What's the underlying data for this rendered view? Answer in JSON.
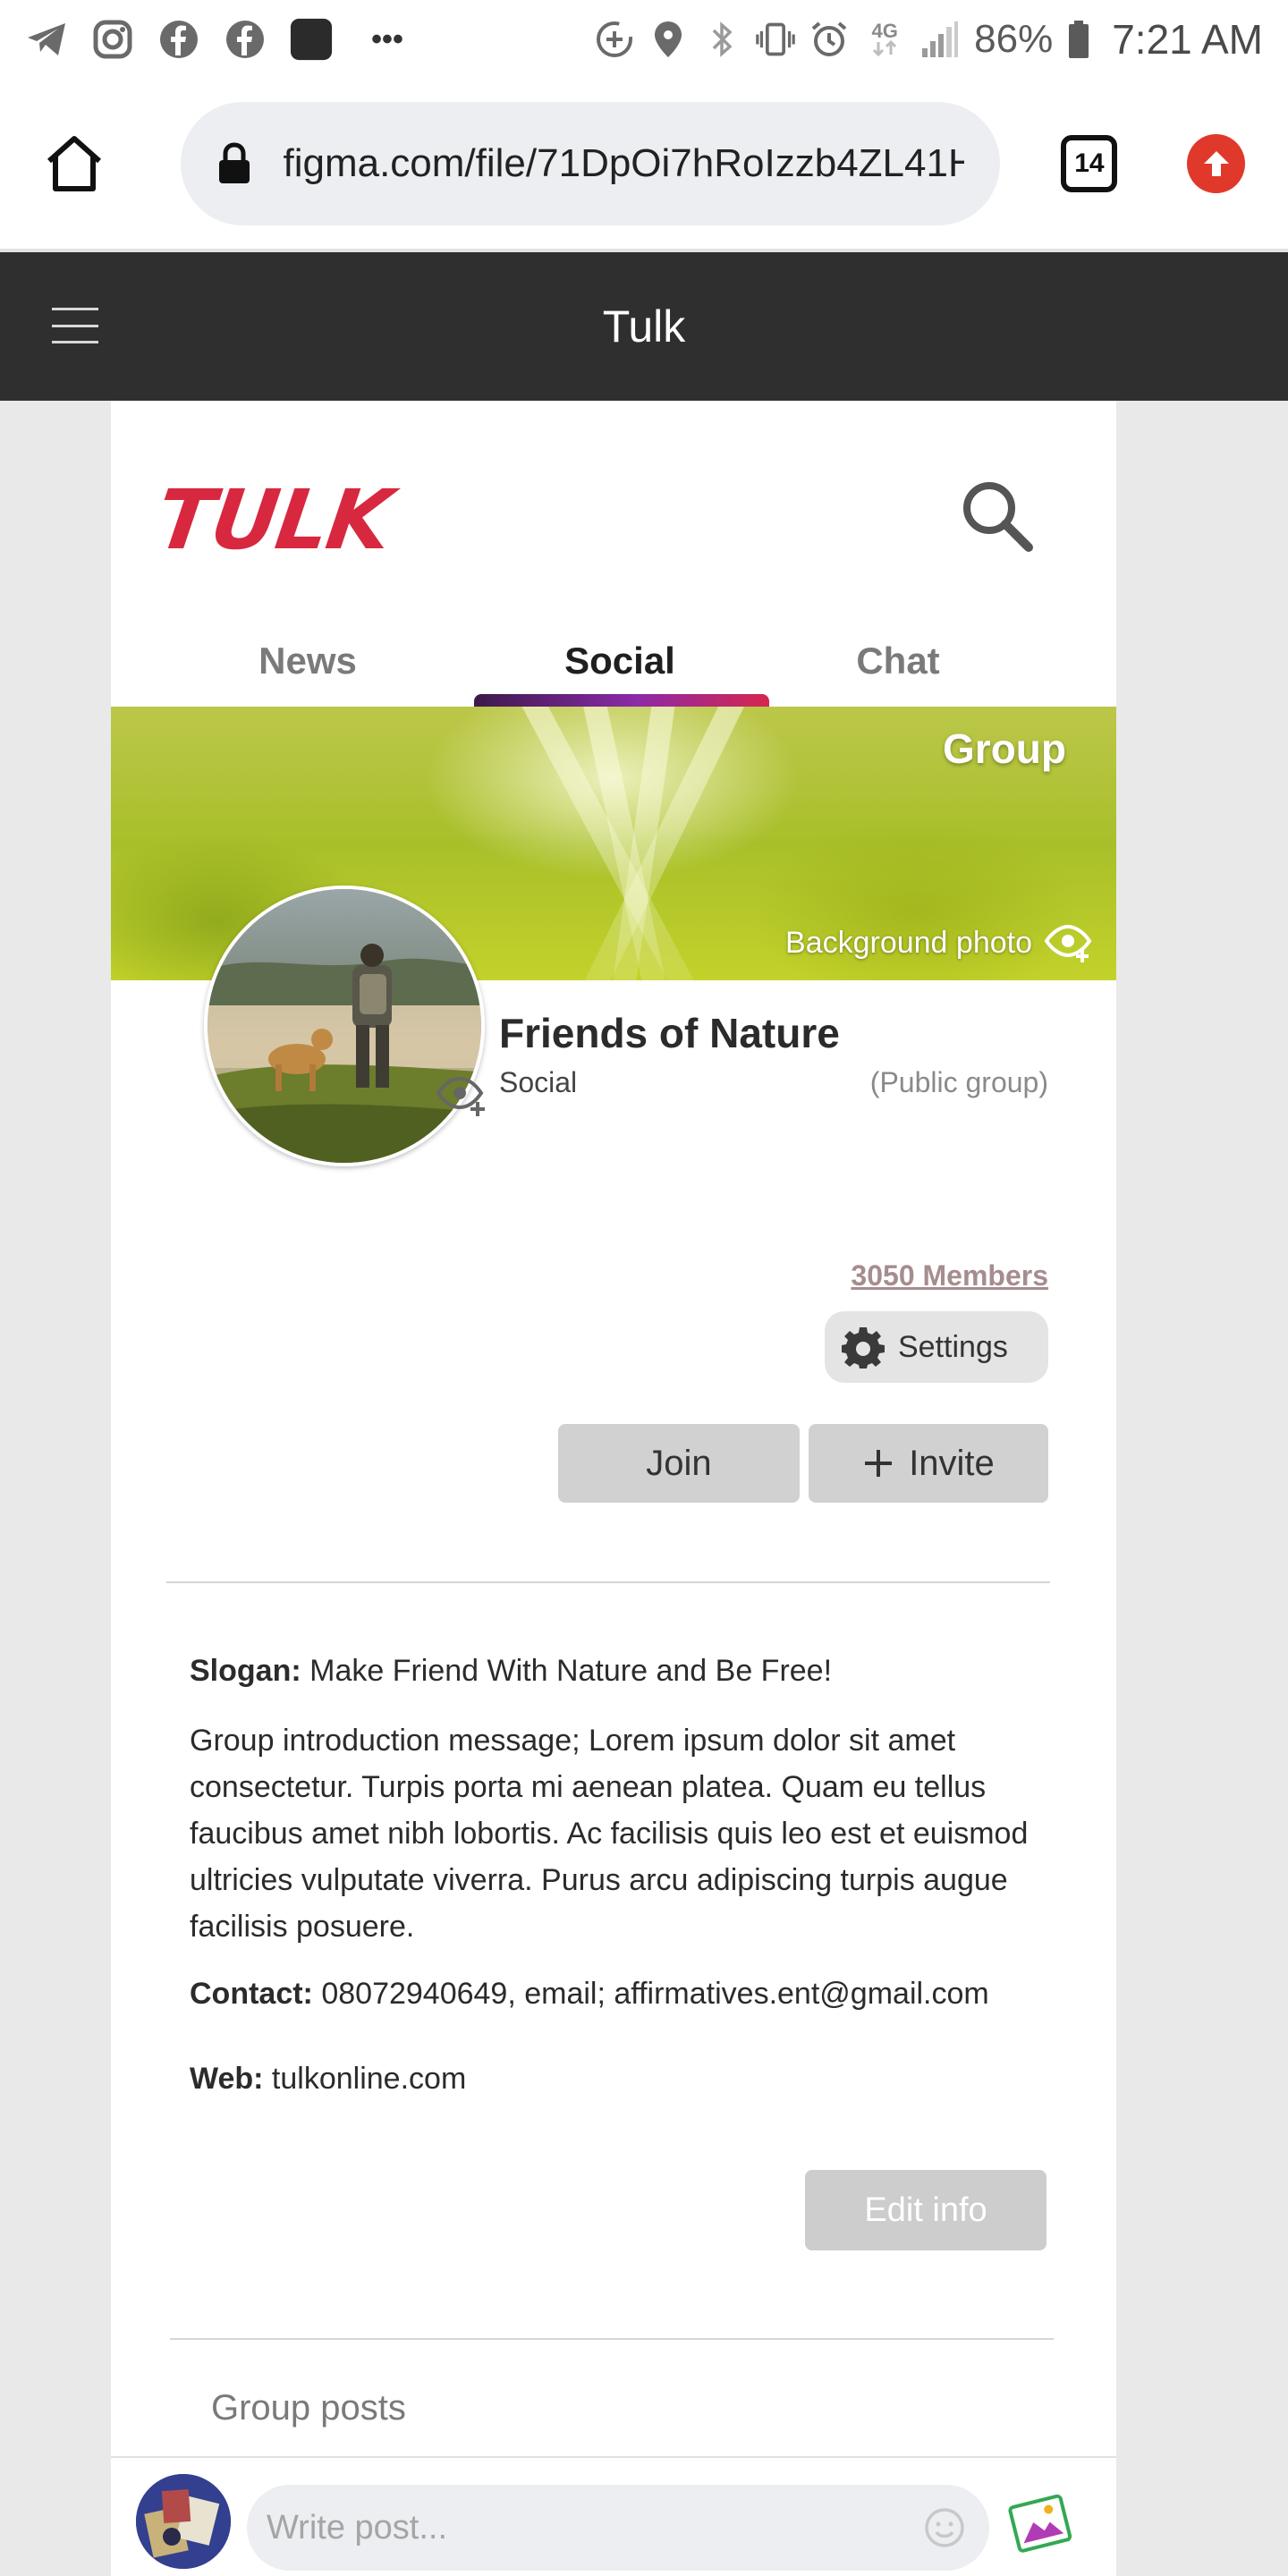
{
  "status_bar": {
    "battery": "86%",
    "time": "7:21 AM",
    "network": "4G",
    "more": "•••",
    "icons": [
      "telegram-icon",
      "instagram-icon",
      "facebook-icon",
      "facebook-icon",
      "app-icon",
      "more-icon",
      "data-saver-icon",
      "location-icon",
      "bluetooth-icon",
      "vibrate-icon",
      "alarm-icon",
      "network-4g-icon",
      "signal-icon",
      "battery-icon"
    ]
  },
  "browser": {
    "url": "figma.com/file/71DpOi7hRoIzzb4ZL41H",
    "tab_count": "14"
  },
  "app_header": {
    "title": "Tulk"
  },
  "app": {
    "logo": "TULK",
    "tabs": [
      {
        "label": "News",
        "active": false
      },
      {
        "label": "Social",
        "active": true
      },
      {
        "label": "Chat",
        "active": false
      }
    ],
    "accent_color": "#d8283f"
  },
  "group": {
    "cover_label": "Group",
    "background_photo_label": "Background photo",
    "name": "Friends of Nature",
    "category": "Social",
    "type": "(Public group)",
    "members": "3050 Members",
    "settings_label": "Settings",
    "join_label": "Join",
    "invite_label": "Invite",
    "slogan_label": "Slogan:",
    "slogan": " Make Friend With Nature and Be Free!",
    "intro": "Group introduction message; Lorem ipsum dolor sit amet consectetur. Turpis porta mi aenean platea. Quam eu tellus faucibus amet nibh lobortis. Ac facilisis quis leo est et euismod ultricies vulputate viverra. Purus arcu adipiscing turpis augue facilisis posuere.",
    "contact_label": "Contact:",
    "contact": " 08072940649,  email; affirmatives.ent@gmail.com",
    "web_label": "Web:",
    "web": " tulkonline.com",
    "edit_label": "Edit info",
    "posts_title": "Group posts"
  },
  "composer": {
    "placeholder": "Write post..."
  }
}
